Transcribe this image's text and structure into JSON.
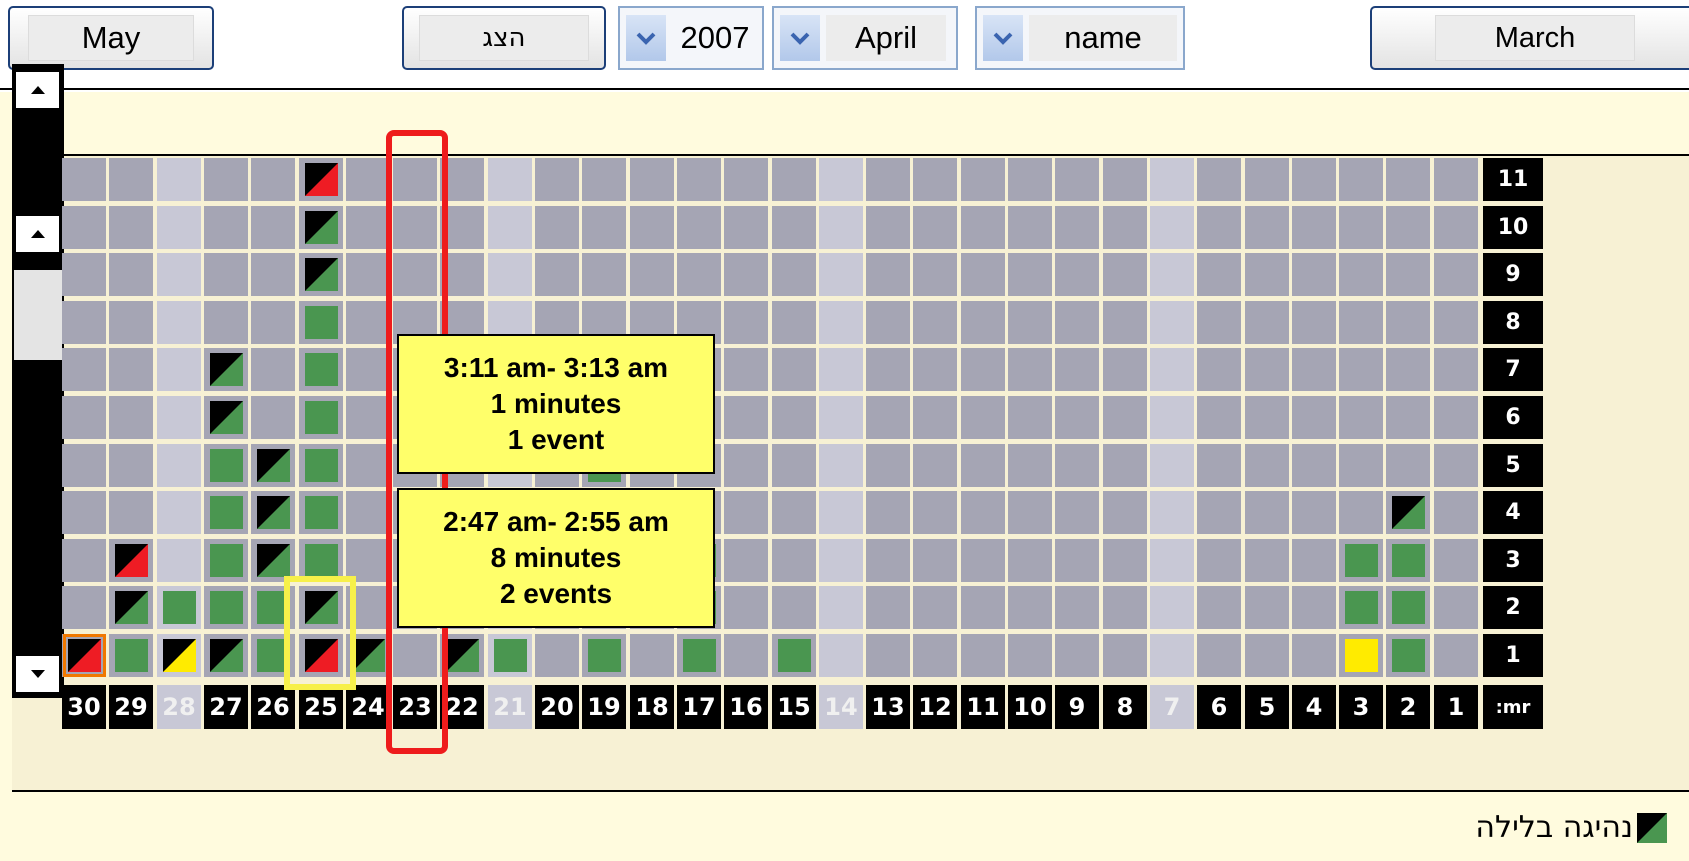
{
  "toolbar": {
    "next_month": "May",
    "show_button": "הצג",
    "year": "2007",
    "month": "April",
    "name": "name",
    "prev_month": "March"
  },
  "legend": {
    "label": "נהיגה בלילה",
    "icon": "night-driving-icon"
  },
  "grid": {
    "hour_header": ":mr",
    "days": [
      "30",
      "29",
      "28",
      "27",
      "26",
      "25",
      "24",
      "23",
      "22",
      "21",
      "20",
      "19",
      "18",
      "17",
      "16",
      "15",
      "14",
      "13",
      "12",
      "11",
      "10",
      "9",
      "8",
      "7",
      "6",
      "5",
      "4",
      "3",
      "2",
      "1"
    ],
    "faded_days": [
      "28",
      "21",
      "14",
      "7"
    ],
    "hours": [
      "11",
      "10",
      "9",
      "8",
      "7",
      "6",
      "5",
      "4",
      "3",
      "2",
      "1"
    ],
    "selected_day": "23"
  },
  "events": [
    {
      "day": "25",
      "hour": "11",
      "type": "red-night"
    },
    {
      "day": "25",
      "hour": "10",
      "type": "green-night"
    },
    {
      "day": "25",
      "hour": "9",
      "type": "green-night"
    },
    {
      "day": "25",
      "hour": "8",
      "type": "green"
    },
    {
      "day": "25",
      "hour": "7",
      "type": "green"
    },
    {
      "day": "25",
      "hour": "6",
      "type": "green"
    },
    {
      "day": "25",
      "hour": "5",
      "type": "green"
    },
    {
      "day": "25",
      "hour": "4",
      "type": "green"
    },
    {
      "day": "25",
      "hour": "3",
      "type": "green"
    },
    {
      "day": "25",
      "hour": "2",
      "type": "green-night"
    },
    {
      "day": "25",
      "hour": "1",
      "type": "red-night"
    },
    {
      "day": "27",
      "hour": "7",
      "type": "green-night"
    },
    {
      "day": "27",
      "hour": "6",
      "type": "green-night"
    },
    {
      "day": "27",
      "hour": "5",
      "type": "green"
    },
    {
      "day": "27",
      "hour": "4",
      "type": "green"
    },
    {
      "day": "27",
      "hour": "3",
      "type": "green"
    },
    {
      "day": "27",
      "hour": "2",
      "type": "green"
    },
    {
      "day": "27",
      "hour": "1",
      "type": "green-night"
    },
    {
      "day": "26",
      "hour": "5",
      "type": "green-night"
    },
    {
      "day": "26",
      "hour": "4",
      "type": "green-night"
    },
    {
      "day": "26",
      "hour": "3",
      "type": "green-night"
    },
    {
      "day": "26",
      "hour": "2",
      "type": "green"
    },
    {
      "day": "26",
      "hour": "1",
      "type": "green"
    },
    {
      "day": "29",
      "hour": "3",
      "type": "red-night"
    },
    {
      "day": "29",
      "hour": "2",
      "type": "green-night"
    },
    {
      "day": "29",
      "hour": "1",
      "type": "green"
    },
    {
      "day": "28",
      "hour": "2",
      "type": "green"
    },
    {
      "day": "28",
      "hour": "1",
      "type": "yellow-night"
    },
    {
      "day": "30",
      "hour": "1",
      "type": "red-night-orange"
    },
    {
      "day": "24",
      "hour": "1",
      "type": "green-night"
    },
    {
      "day": "22",
      "hour": "1",
      "type": "green-night"
    },
    {
      "day": "21",
      "hour": "1",
      "type": "green"
    },
    {
      "day": "19",
      "hour": "1",
      "type": "green"
    },
    {
      "day": "19",
      "hour": "5",
      "type": "green"
    },
    {
      "day": "17",
      "hour": "3",
      "type": "green"
    },
    {
      "day": "17",
      "hour": "2",
      "type": "green"
    },
    {
      "day": "17",
      "hour": "1",
      "type": "green"
    },
    {
      "day": "15",
      "hour": "1",
      "type": "green"
    },
    {
      "day": "3",
      "hour": "3",
      "type": "green"
    },
    {
      "day": "3",
      "hour": "2",
      "type": "green"
    },
    {
      "day": "3",
      "hour": "1",
      "type": "yellow"
    },
    {
      "day": "2",
      "hour": "4",
      "type": "green-night"
    },
    {
      "day": "2",
      "hour": "3",
      "type": "green"
    },
    {
      "day": "2",
      "hour": "2",
      "type": "green"
    },
    {
      "day": "2",
      "hour": "1",
      "type": "green"
    }
  ],
  "tooltips": [
    {
      "time": "3:11 am- 3:13 am",
      "duration": "1 minutes",
      "count": "1 event"
    },
    {
      "time": "2:47 am- 2:55 am",
      "duration": "8 minutes",
      "count": "2 events"
    }
  ],
  "colors": {
    "cell": "#a5a5b4",
    "cell_faded": "#c8c8d6",
    "green": "#4a9650",
    "red": "#ee1c24",
    "yellow": "#ffeb00",
    "night": "#000000",
    "tooltip": "#ffff6a",
    "board": "#fffbde",
    "highlight_red": "#ee1c1c",
    "highlight_yellow": "#f7f04a"
  }
}
